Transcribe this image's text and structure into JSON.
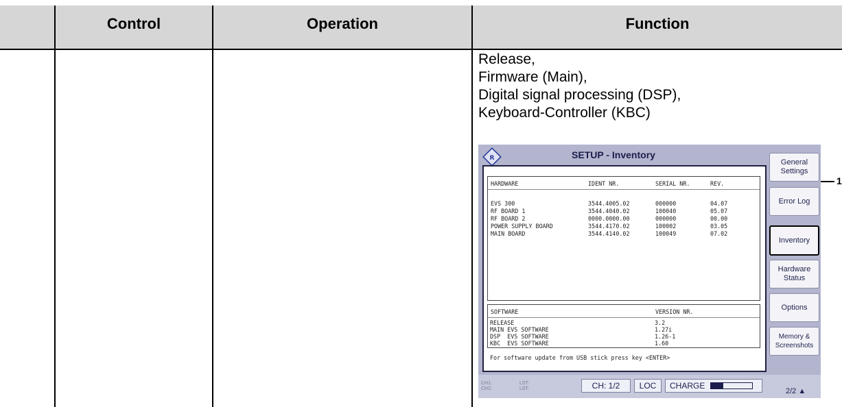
{
  "table": {
    "headers": [
      "Control",
      "Operation",
      "Function"
    ],
    "function_lines": [
      "Release,",
      "Firmware (Main),",
      "Digital signal processing (DSP),",
      "Keyboard-Controller (KBC)"
    ]
  },
  "device": {
    "title": "SETUP - Inventory",
    "hardware_header": [
      "HARDWARE",
      "IDENT NR.",
      "SERIAL NR.",
      "REV."
    ],
    "hardware_rows": [
      [
        "EVS 300",
        "3544.4005.02",
        "000000",
        "04.07"
      ],
      [
        "RF BOARD 1",
        "3544.4040.02",
        "100040",
        "05.07"
      ],
      [
        "RF BOARD 2",
        "0000.0000.00",
        "000000",
        "00.00"
      ],
      [
        "POWER SUPPLY BOARD",
        "3544.4170.02",
        "100002",
        "03.05"
      ],
      [
        "MAIN BOARD",
        "3544.4140.02",
        "100049",
        "07.02"
      ]
    ],
    "software_header": [
      "SOFTWARE",
      "VERSION NR."
    ],
    "software_rows": [
      [
        "RELEASE",
        "3.2"
      ],
      [
        "MAIN EVS SOFTWARE",
        "1.27i"
      ],
      [
        "DSP  EVS SOFTWARE",
        "1.26-1"
      ],
      [
        "KBC  EVS SOFTWARE",
        "1.60"
      ]
    ],
    "footnote": "For software update from USB stick press key <ENTER>",
    "softkeys": {
      "general": "General Settings",
      "error_log": "Error Log",
      "inventory": "Inventory",
      "hardware": "Hardware Status",
      "options": "Options",
      "memory": "Memory & Screenshots"
    },
    "status": {
      "ch1": "CH1:",
      "ch2": "CH2:",
      "lst1": "LST:",
      "lst2": "LST:",
      "channel": "CH: 1/2",
      "loc": "LOC",
      "charge": "CHARGE",
      "charge_level": 0.3,
      "page": "2/2 ▲"
    },
    "colors": {
      "background": "#b3b5cf",
      "accent": "#20234e"
    }
  },
  "callout": "1"
}
